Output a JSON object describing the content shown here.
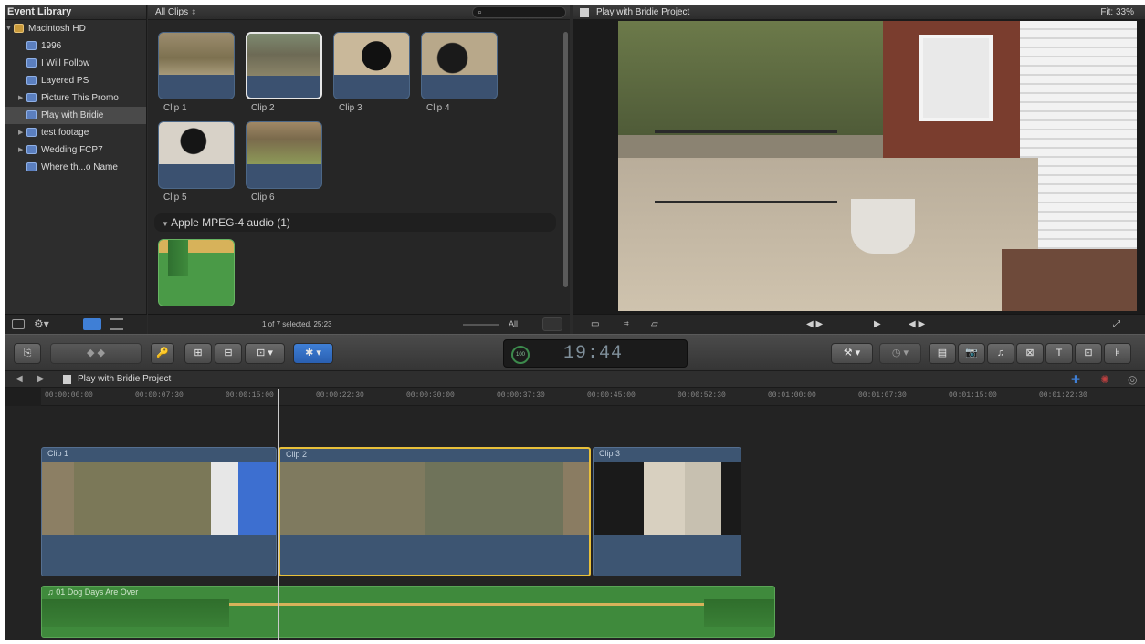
{
  "library": {
    "title": "Event Library",
    "items": [
      {
        "label": "Macintosh HD",
        "type": "drive",
        "expanded": true,
        "selected": false
      },
      {
        "label": "1996",
        "type": "event",
        "selected": false
      },
      {
        "label": "I Will Follow",
        "type": "event",
        "selected": false
      },
      {
        "label": "Layered PS",
        "type": "event",
        "selected": false
      },
      {
        "label": "Picture This Promo",
        "type": "event",
        "selected": false
      },
      {
        "label": "Play with Bridie",
        "type": "event",
        "selected": true
      },
      {
        "label": "test footage",
        "type": "event",
        "selected": false
      },
      {
        "label": "Wedding FCP7",
        "type": "event",
        "selected": false
      },
      {
        "label": "Where th...o Name",
        "type": "event",
        "selected": false
      }
    ]
  },
  "browser": {
    "filter": "All Clips",
    "clips": [
      {
        "label": "Clip 1",
        "selected": false
      },
      {
        "label": "Clip 2",
        "selected": true
      },
      {
        "label": "Clip 3",
        "selected": false
      },
      {
        "label": "Clip 4",
        "selected": false
      },
      {
        "label": "Clip 5",
        "selected": false
      },
      {
        "label": "Clip 6",
        "selected": false
      }
    ],
    "section_label": "Apple MPEG-4 audio  (1)",
    "status": "1 of 7 selected, 25:23",
    "all_label": "All"
  },
  "viewer": {
    "title": "Play with Bridie Project",
    "fit": "Fit: 33%"
  },
  "toolbar": {
    "timecode": "19:44",
    "timecode_ring": "100"
  },
  "timeline": {
    "project_title": "Play with Bridie Project",
    "ruler": [
      "00:00:00:00",
      "00:00:07:30",
      "00:00:15:00",
      "00:00:22:30",
      "00:00:30:00",
      "00:00:37:30",
      "00:00:45:00",
      "00:00:52:30",
      "00:01:00:00",
      "00:01:07:30",
      "00:01:15:00",
      "00:01:22:30"
    ],
    "video_clips": [
      {
        "label": "Clip 1"
      },
      {
        "label": "Clip 2"
      },
      {
        "label": "Clip 3"
      }
    ],
    "audio_clip": "Dog Days Are Over"
  },
  "colors": {
    "accent_blue": "#3f7fd6",
    "video_clip": "#3d5572",
    "audio_clip": "#3f8a3c",
    "selection_yellow": "#e8c03a"
  }
}
